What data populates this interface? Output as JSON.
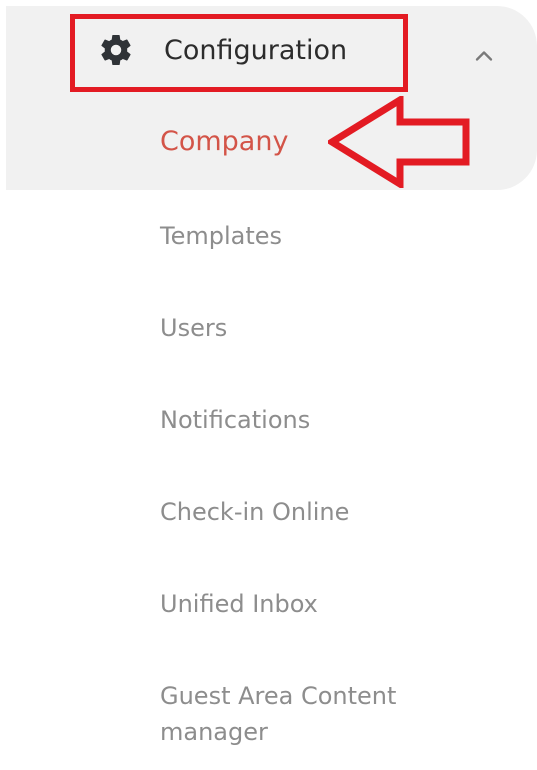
{
  "nav": {
    "section_label": "Configuration",
    "section_icon": "gear-icon",
    "toggle_icon": "chevron-up-icon",
    "items": [
      {
        "label": "Company",
        "active": true
      },
      {
        "label": "Templates",
        "active": false
      },
      {
        "label": "Users",
        "active": false
      },
      {
        "label": "Notifications",
        "active": false
      },
      {
        "label": "Check-in Online",
        "active": false
      },
      {
        "label": "Unified Inbox",
        "active": false
      },
      {
        "label": "Guest Area Content manager",
        "active": false
      }
    ]
  },
  "colors": {
    "active_text": "#d35448",
    "inactive_text": "#8d8d8d",
    "header_text": "#2c2c2c",
    "group_background": "#f1f1f1",
    "annotation_red": "#e31b23"
  }
}
